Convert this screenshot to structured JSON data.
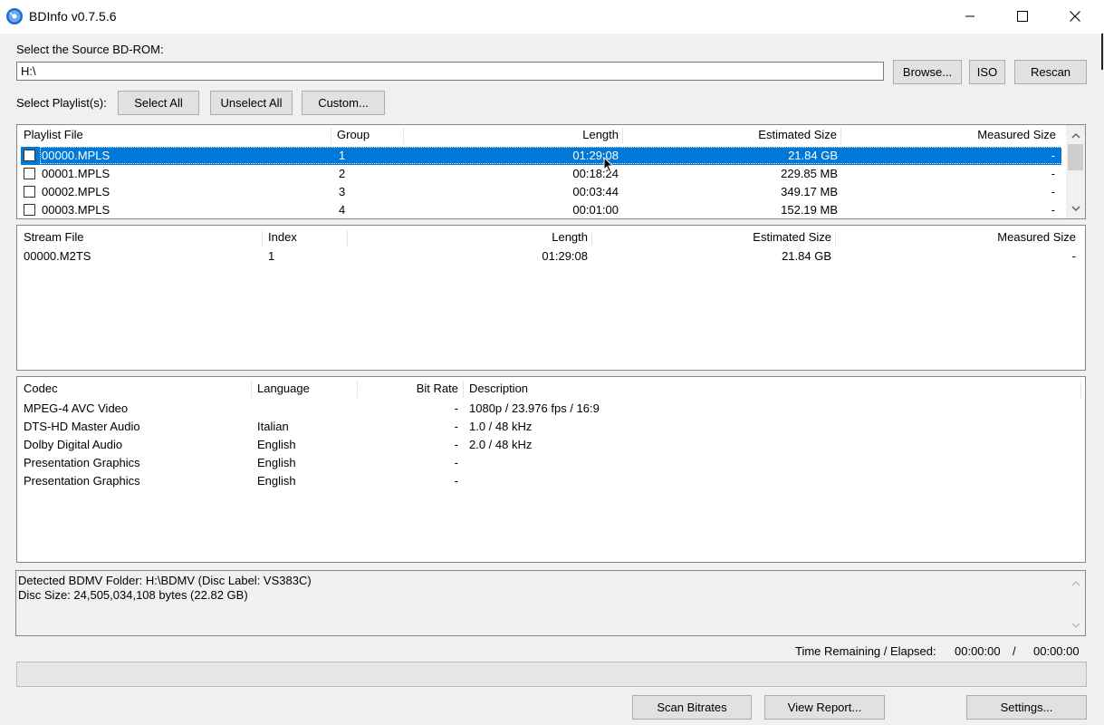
{
  "window": {
    "title": "BDInfo v0.7.5.6"
  },
  "source": {
    "label": "Select the Source BD-ROM:",
    "path": "H:\\",
    "browse_label": "Browse...",
    "iso_label": "ISO",
    "rescan_label": "Rescan"
  },
  "playlist_select": {
    "label": "Select Playlist(s):",
    "select_all_label": "Select All",
    "unselect_all_label": "Unselect All",
    "custom_label": "Custom..."
  },
  "playlists": {
    "headers": [
      "Playlist File",
      "Group",
      "Length",
      "Estimated Size",
      "Measured Size"
    ],
    "rows": [
      {
        "file": "00000.MPLS",
        "group": "1",
        "length": "01:29:08",
        "estimated": "21.84 GB",
        "measured": "-"
      },
      {
        "file": "00001.MPLS",
        "group": "2",
        "length": "00:18:24",
        "estimated": "229.85 MB",
        "measured": "-"
      },
      {
        "file": "00002.MPLS",
        "group": "3",
        "length": "00:03:44",
        "estimated": "349.17 MB",
        "measured": "-"
      },
      {
        "file": "00003.MPLS",
        "group": "4",
        "length": "00:01:00",
        "estimated": "152.19 MB",
        "measured": "-"
      }
    ]
  },
  "streams": {
    "headers": [
      "Stream File",
      "Index",
      "Length",
      "Estimated Size",
      "Measured Size"
    ],
    "rows": [
      {
        "file": "00000.M2TS",
        "index": "1",
        "length": "01:29:08",
        "estimated": "21.84 GB",
        "measured": "-"
      }
    ]
  },
  "codecs": {
    "headers": [
      "Codec",
      "Language",
      "Bit Rate",
      "Description"
    ],
    "rows": [
      {
        "codec": "MPEG-4 AVC Video",
        "language": "",
        "bitrate": "-",
        "description": "1080p / 23.976 fps / 16:9"
      },
      {
        "codec": "DTS-HD Master Audio",
        "language": "Italian",
        "bitrate": "-",
        "description": "1.0 / 48 kHz"
      },
      {
        "codec": "Dolby Digital Audio",
        "language": "English",
        "bitrate": "-",
        "description": "2.0 / 48 kHz"
      },
      {
        "codec": "Presentation Graphics",
        "language": "English",
        "bitrate": "-",
        "description": ""
      },
      {
        "codec": "Presentation Graphics",
        "language": "English",
        "bitrate": "-",
        "description": ""
      }
    ]
  },
  "log": {
    "lines": [
      "Detected BDMV Folder: H:\\BDMV (Disc Label: VS383C)",
      "Disc Size: 24,505,034,108 bytes (22.82 GB)"
    ]
  },
  "status": {
    "time_label": "Time Remaining / Elapsed:",
    "remaining": "00:00:00",
    "separator": "/",
    "elapsed": "00:00:00",
    "progress": 0
  },
  "footer": {
    "scan_label": "Scan Bitrates",
    "report_label": "View Report...",
    "settings_label": "Settings..."
  },
  "colors": {
    "selection": "#0078d7",
    "window_bg": "#f0f0f0"
  },
  "icons": {
    "app": "bluray-disc-icon",
    "minimize": "minimize-icon",
    "maximize": "maximize-icon",
    "close": "close-icon"
  }
}
